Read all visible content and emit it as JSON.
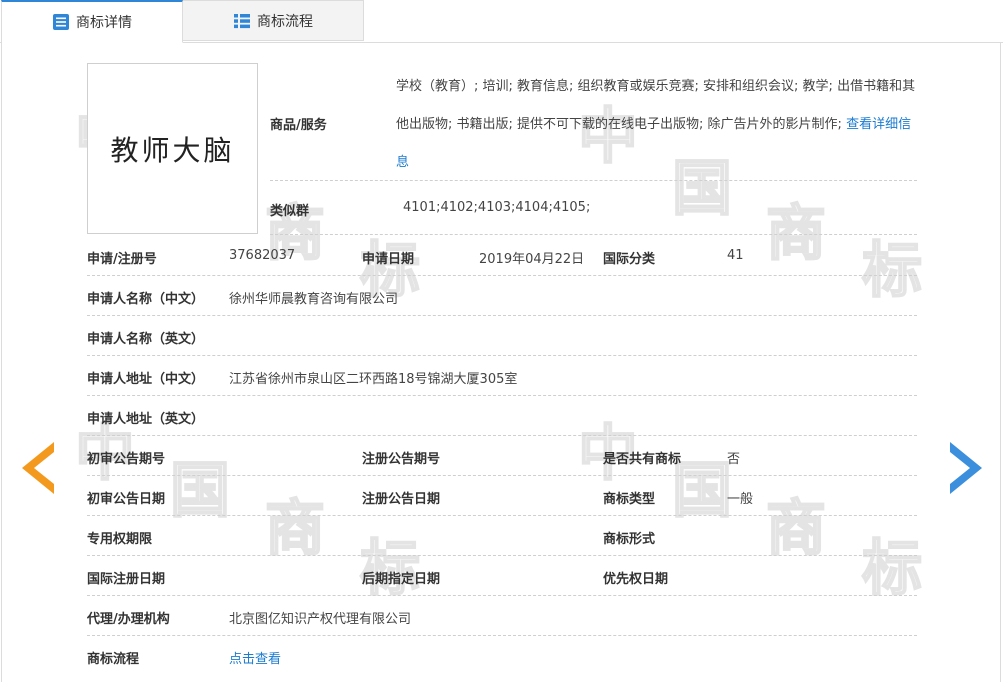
{
  "tabs": [
    {
      "label": "商标详情",
      "icon": "detail-list-icon",
      "active": true
    },
    {
      "label": "商标流程",
      "icon": "flow-list-icon",
      "active": false
    }
  ],
  "logo": {
    "text": "教师大脑"
  },
  "watermark": {
    "chars": [
      "中",
      "国",
      "商",
      "标"
    ]
  },
  "goods": {
    "label": "商品/服务",
    "text": "学校（教育）; 培训; 教育信息; 组织教育或娱乐竞赛; 安排和组织会议; 教学; 出借书籍和其他出版物; 书籍出版; 提供不可下载的在线电子出版物; 除广告片外的影片制作;",
    "more_link": "查看详细信息"
  },
  "similar": {
    "label": "类似群",
    "value": "4101;4102;4103;4104;4105;"
  },
  "fields": {
    "reg_no_label": "申请/注册号",
    "reg_no": "37682037",
    "apply_date_label": "申请日期",
    "apply_date": "2019年04月22日",
    "intl_class_label": "国际分类",
    "intl_class": "41",
    "applicant_cn_label": "申请人名称（中文）",
    "applicant_cn": "徐州华师晨教育咨询有限公司",
    "applicant_en_label": "申请人名称（英文）",
    "applicant_en": "",
    "address_cn_label": "申请人地址（中文）",
    "address_cn": "江苏省徐州市泉山区二环西路18号锦湖大厦305室",
    "address_en_label": "申请人地址（英文）",
    "address_en": "",
    "prelim_no_label": "初审公告期号",
    "prelim_no": "",
    "reg_pub_no_label": "注册公告期号",
    "reg_pub_no": "",
    "shared_label": "是否共有商标",
    "shared": "否",
    "prelim_date_label": "初审公告日期",
    "prelim_date": "",
    "reg_pub_date_label": "注册公告日期",
    "reg_pub_date": "",
    "tm_type_label": "商标类型",
    "tm_type": "一般",
    "exclusive_label": "专用权期限",
    "exclusive": "",
    "tm_form_label": "商标形式",
    "tm_form": "",
    "intl_reg_date_label": "国际注册日期",
    "intl_reg_date": "",
    "later_date_label": "后期指定日期",
    "later_date": "",
    "priority_label": "优先权日期",
    "priority": "",
    "agent_label": "代理/办理机构",
    "agent": "北京图亿知识产权代理有限公司",
    "flow_label": "商标流程",
    "flow_link": "点击查看"
  },
  "nav": {
    "prev_icon": "arrow-left-icon",
    "next_icon": "arrow-right-icon"
  },
  "colors": {
    "accent": "#2f86d6",
    "link": "#1a7bd1",
    "prev_arrow": "#f39a1e",
    "next_arrow": "#3b8fdc"
  }
}
